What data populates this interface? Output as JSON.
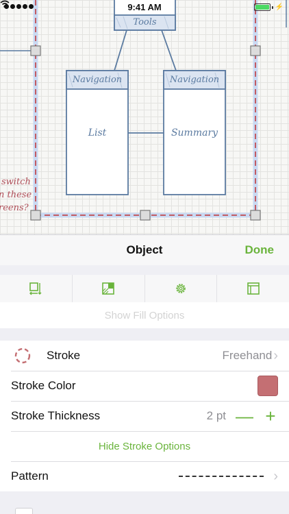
{
  "status_bar": {
    "time": "9:41 AM"
  },
  "diagram": {
    "nodes": {
      "tools": "Tools",
      "nav_left": "Navigation",
      "nav_right": "Navigation",
      "list": "List",
      "summary": "Summary"
    },
    "annotation": [
      "switch",
      "n these",
      "reens?"
    ]
  },
  "inspector": {
    "title": "Object",
    "done_label": "Done",
    "tabs": [
      "frame-icon",
      "fill-icon",
      "gear-icon",
      "canvas-icon"
    ],
    "show_fill_options": "Show Fill Options",
    "stroke": {
      "label": "Stroke",
      "value": "Freehand"
    },
    "stroke_color": {
      "label": "Stroke Color",
      "color": "#c46f73"
    },
    "stroke_thickness": {
      "label": "Stroke Thickness",
      "value": "2 pt"
    },
    "hide_stroke_options": "Hide Stroke Options",
    "pattern": {
      "label": "Pattern"
    }
  },
  "colors": {
    "accent": "#6ab43c",
    "stroke": "#c46f73",
    "diagram_blue": "#5a7aa0"
  }
}
